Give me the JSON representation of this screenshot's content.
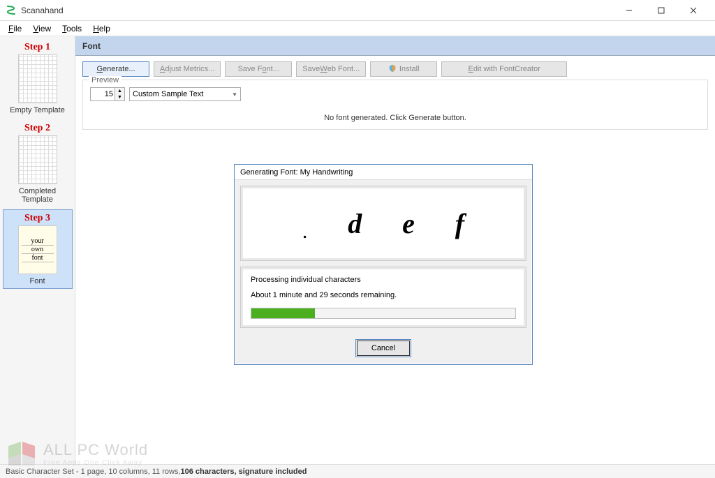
{
  "window": {
    "title": "Scanahand"
  },
  "menus": {
    "file": "File",
    "view": "View",
    "tools": "Tools",
    "help": "Help"
  },
  "sidebar": {
    "step1_title": "Step 1",
    "step1_label": "Empty Template",
    "step2_title": "Step 2",
    "step2_label": "Completed Template",
    "step3_title": "Step 3",
    "step3_label": "Font",
    "font_thumb_line1": "your",
    "font_thumb_line2": "own",
    "font_thumb_line3": "font"
  },
  "content": {
    "header": "Font",
    "toolbar": {
      "generate": "Generate...",
      "adjust": "Adjust Metrics...",
      "save": "Save Font...",
      "saveweb": "Save Web Font...",
      "install": "Install",
      "edit": "Edit with FontCreator"
    },
    "preview": {
      "legend": "Preview",
      "size": "15",
      "sample": "Custom Sample Text",
      "message": "No font generated. Click Generate button."
    }
  },
  "dialog": {
    "title": "Generating Font: My Handwriting",
    "glyphs": {
      "dot": ".",
      "d": "d",
      "e": "e",
      "f": "f"
    },
    "status_line1": "Processing individual characters",
    "status_line2": "About 1 minute and 29 seconds remaining.",
    "cancel": "Cancel"
  },
  "statusbar": {
    "text_prefix": "Basic Character Set - 1 page, 10 columns, 11 rows, ",
    "text_bold": "106 characters, signature included"
  },
  "watermark": {
    "title": "ALL PC World",
    "subtitle": "Free Apps One Click Away"
  }
}
